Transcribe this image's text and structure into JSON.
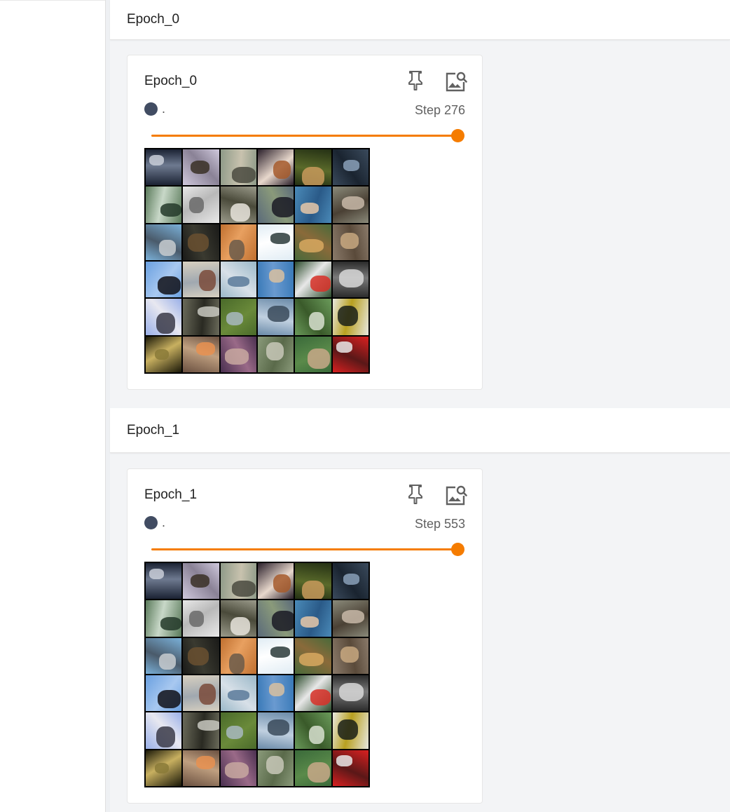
{
  "groups": [
    {
      "header": "Epoch_0",
      "card": {
        "title": "Epoch_0",
        "run": ".",
        "step_label": "Step 276",
        "step": 276,
        "slider_fraction": 1.0,
        "run_color": "#414c62",
        "accent": "#f57c00"
      }
    },
    {
      "header": "Epoch_1",
      "card": {
        "title": "Epoch_1",
        "run": ".",
        "step_label": "Step 553",
        "step": 553,
        "slider_fraction": 1.0,
        "run_color": "#414c62",
        "accent": "#f57c00"
      }
    }
  ],
  "icons": {
    "pin": "pin-icon",
    "zoom": "image-search-icon"
  },
  "image_grid": {
    "rows": 6,
    "cols": 6,
    "tiles": [
      {
        "subject": "boat",
        "c1": "#1b2233",
        "c2": "#c9ced8",
        "c3": "#6e7a90"
      },
      {
        "subject": "deer",
        "c1": "#cfc8dc",
        "c2": "#3a3026",
        "c3": "#8a8296"
      },
      {
        "subject": "truck",
        "c1": "#8e9a88",
        "c2": "#4a4a40",
        "c3": "#c8c2ae"
      },
      {
        "subject": "dog",
        "c1": "#2a1f2a",
        "c2": "#a65a2c",
        "c3": "#e8d8cc"
      },
      {
        "subject": "deer",
        "c1": "#243014",
        "c2": "#c89a5c",
        "c3": "#5a6a2a"
      },
      {
        "subject": "car",
        "c1": "#3a4a5c",
        "c2": "#8aa0b8",
        "c3": "#1a2430"
      },
      {
        "subject": "horse",
        "c1": "#5a7a5a",
        "c2": "#243a2a",
        "c3": "#c8d8c8"
      },
      {
        "subject": "horse",
        "c1": "#e8e8e8",
        "c2": "#6a6a6a",
        "c3": "#b8b8b8"
      },
      {
        "subject": "horse",
        "c1": "#9a9a8a",
        "c2": "#e8e4dc",
        "c3": "#4a4a3a"
      },
      {
        "subject": "horse",
        "c1": "#5a6a7a",
        "c2": "#1a1a24",
        "c3": "#8a9a7a"
      },
      {
        "subject": "airplane",
        "c1": "#4a8ab8",
        "c2": "#e8c8a8",
        "c3": "#2a5a88"
      },
      {
        "subject": "cat",
        "c1": "#8a8a7a",
        "c2": "#c8b8a8",
        "c3": "#4a4034"
      },
      {
        "subject": "ship",
        "c1": "#7ab0d8",
        "c2": "#c8ccd0",
        "c3": "#4a5a6a"
      },
      {
        "subject": "cat",
        "c1": "#1a1a18",
        "c2": "#6a5030",
        "c3": "#3a3a30"
      },
      {
        "subject": "cat",
        "c1": "#c07030",
        "c2": "#6a5a4a",
        "c3": "#e8a060"
      },
      {
        "subject": "airplane",
        "c1": "#e0ecf4",
        "c2": "#2a3a3a",
        "c3": "#ffffff"
      },
      {
        "subject": "dog",
        "c1": "#4a6a3a",
        "c2": "#d8a860",
        "c3": "#8a6a3a"
      },
      {
        "subject": "deer",
        "c1": "#8a7a6a",
        "c2": "#c8a880",
        "c3": "#5a4a3a"
      },
      {
        "subject": "airplane",
        "c1": "#6aa0e0",
        "c2": "#101018",
        "c3": "#a8c8f0"
      },
      {
        "subject": "ship",
        "c1": "#d8d0c0",
        "c2": "#7a4a3a",
        "c3": "#a0a8b0"
      },
      {
        "subject": "airplane",
        "c1": "#9ab8c8",
        "c2": "#5a7a9a",
        "c3": "#d8e0e8"
      },
      {
        "subject": "bird",
        "c1": "#3a7ab8",
        "c2": "#d8c0a0",
        "c3": "#6a9ad0"
      },
      {
        "subject": "truck",
        "c1": "#2a4a2a",
        "c2": "#d83028",
        "c3": "#e8e8e8"
      },
      {
        "subject": "bird",
        "c1": "#2a2a2a",
        "c2": "#d8d8d8",
        "c3": "#7a7a7a"
      },
      {
        "subject": "bird",
        "c1": "#9ab0e8",
        "c2": "#3a3a48",
        "c3": "#e8e8f0"
      },
      {
        "subject": "cat",
        "c1": "#6a6a5a",
        "c2": "#c8c8c0",
        "c3": "#2a2a22"
      },
      {
        "subject": "deer",
        "c1": "#4a6a2a",
        "c2": "#a8b8c0",
        "c3": "#6a8a3a"
      },
      {
        "subject": "ship",
        "c1": "#6a8aa8",
        "c2": "#3a4a5a",
        "c3": "#c0d0e0"
      },
      {
        "subject": "frog",
        "c1": "#6a9a5a",
        "c2": "#d8e0d0",
        "c3": "#3a5a2a"
      },
      {
        "subject": "bird",
        "c1": "#e8e8e0",
        "c2": "#1a2018",
        "c3": "#b8a020"
      },
      {
        "subject": "frog",
        "c1": "#1a1808",
        "c2": "#8a7a38",
        "c3": "#c8b060"
      },
      {
        "subject": "cat",
        "c1": "#6a5040",
        "c2": "#e89050",
        "c3": "#c0a080"
      },
      {
        "subject": "dog",
        "c1": "#4a3050",
        "c2": "#c8a8a0",
        "c3": "#9a6a88"
      },
      {
        "subject": "frog",
        "c1": "#8a9a7a",
        "c2": "#c8c8b8",
        "c3": "#5a6a4a"
      },
      {
        "subject": "bird",
        "c1": "#3a6a3a",
        "c2": "#c8a888",
        "c3": "#5a8a4a"
      },
      {
        "subject": "truck",
        "c1": "#d82020",
        "c2": "#e8e8e8",
        "c3": "#5a1818"
      }
    ]
  }
}
